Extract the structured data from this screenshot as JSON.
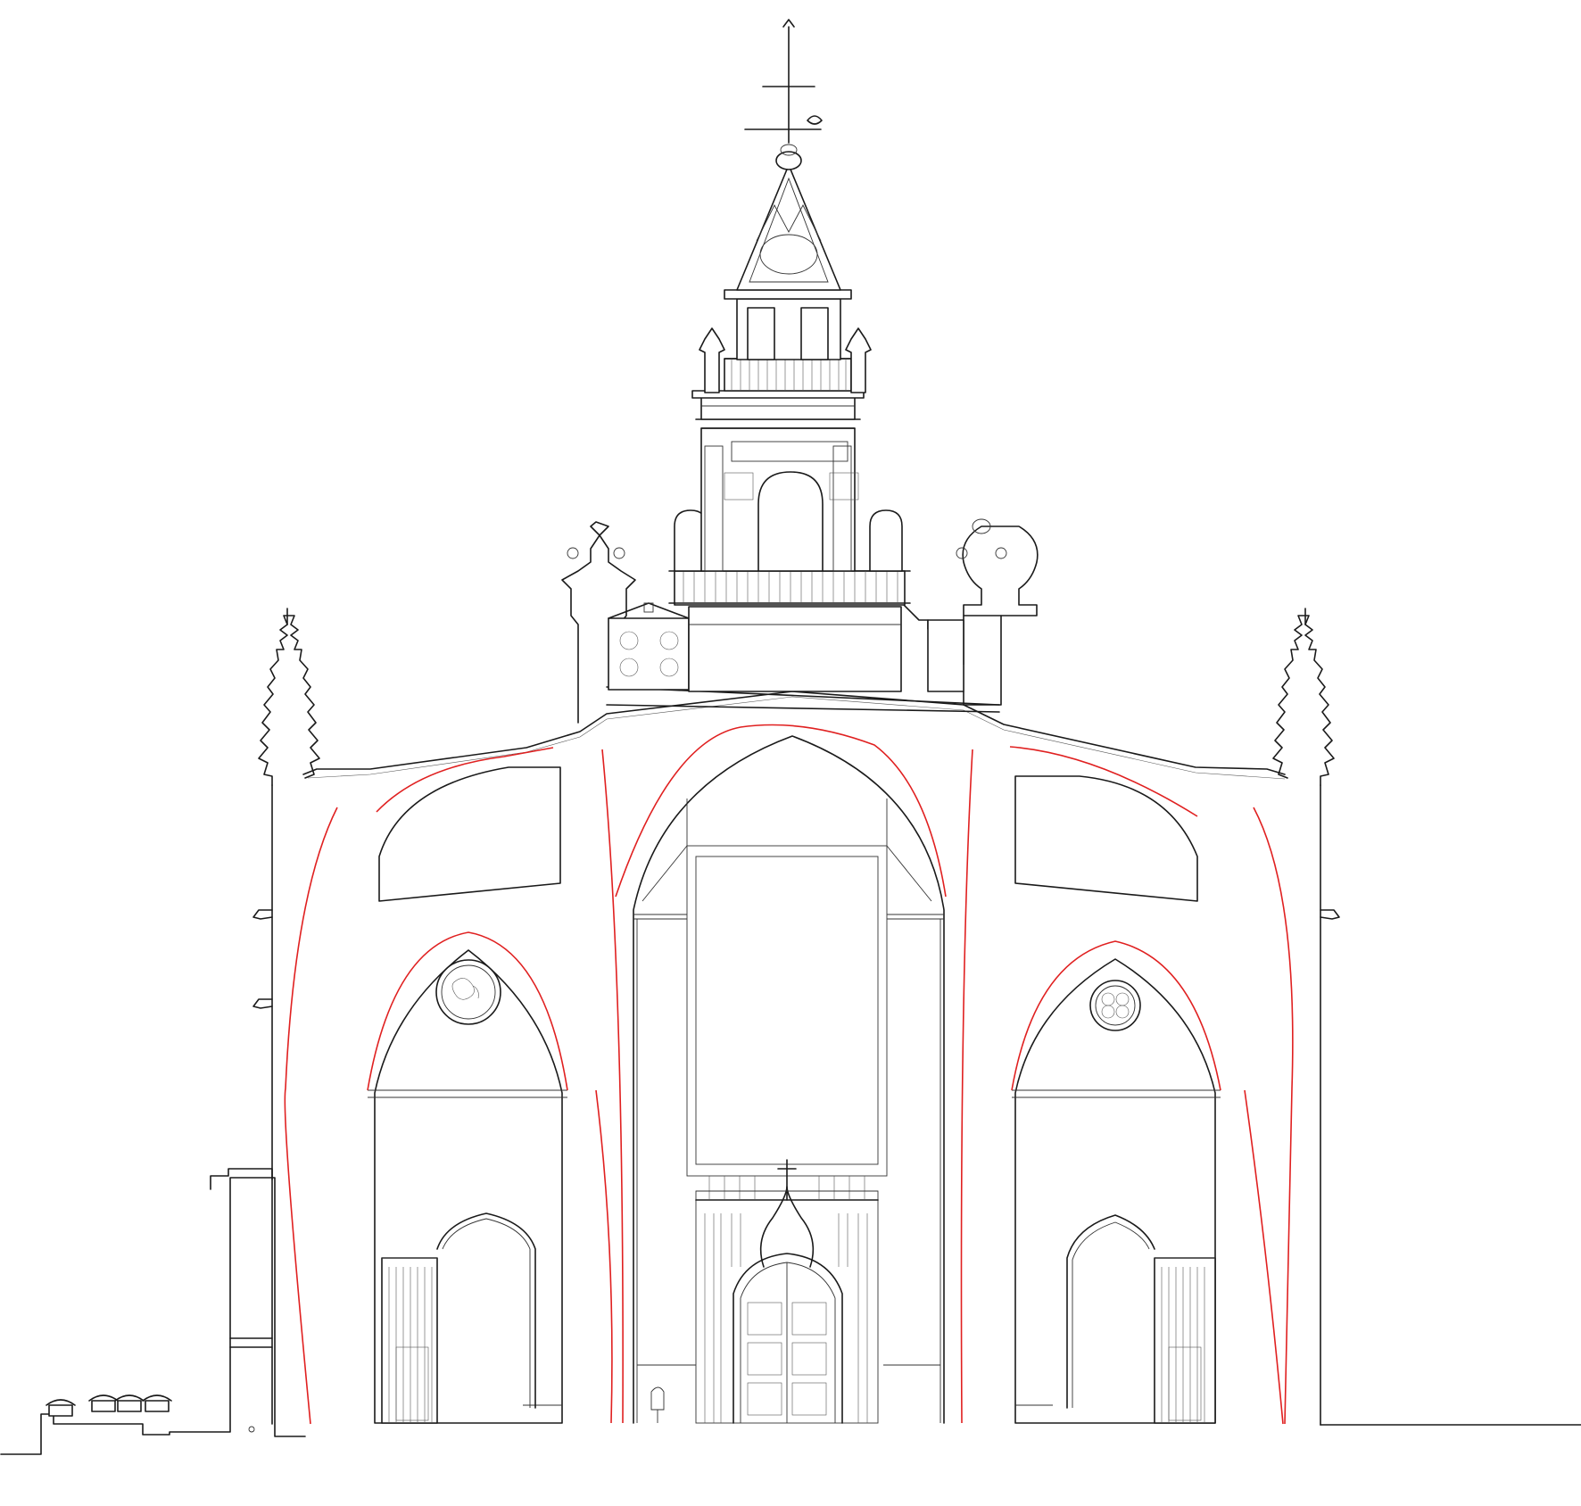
{
  "drawing": {
    "kind": "architectural section elevation",
    "background_color": "#ffffff",
    "line_color": "#1a1a1a",
    "annotation_line_color": "#e02020",
    "visible_text": []
  },
  "elements": {
    "bell_tower": "bell-tower",
    "weathervane": "weathervane-cross",
    "nave_arch": "central-nave-arch",
    "side_arches": [
      "left-aisle-arch",
      "right-aisle-arch"
    ],
    "main_portal": "main-portal-door",
    "side_portals": [
      "left-side-portal",
      "right-side-portal"
    ],
    "rose_windows": [
      "left-rose-window",
      "right-rose-window"
    ],
    "pinnacles": [
      "left-pinnacle",
      "right-pinnacle"
    ],
    "vault_curves": "red-vault-profile-lines"
  }
}
